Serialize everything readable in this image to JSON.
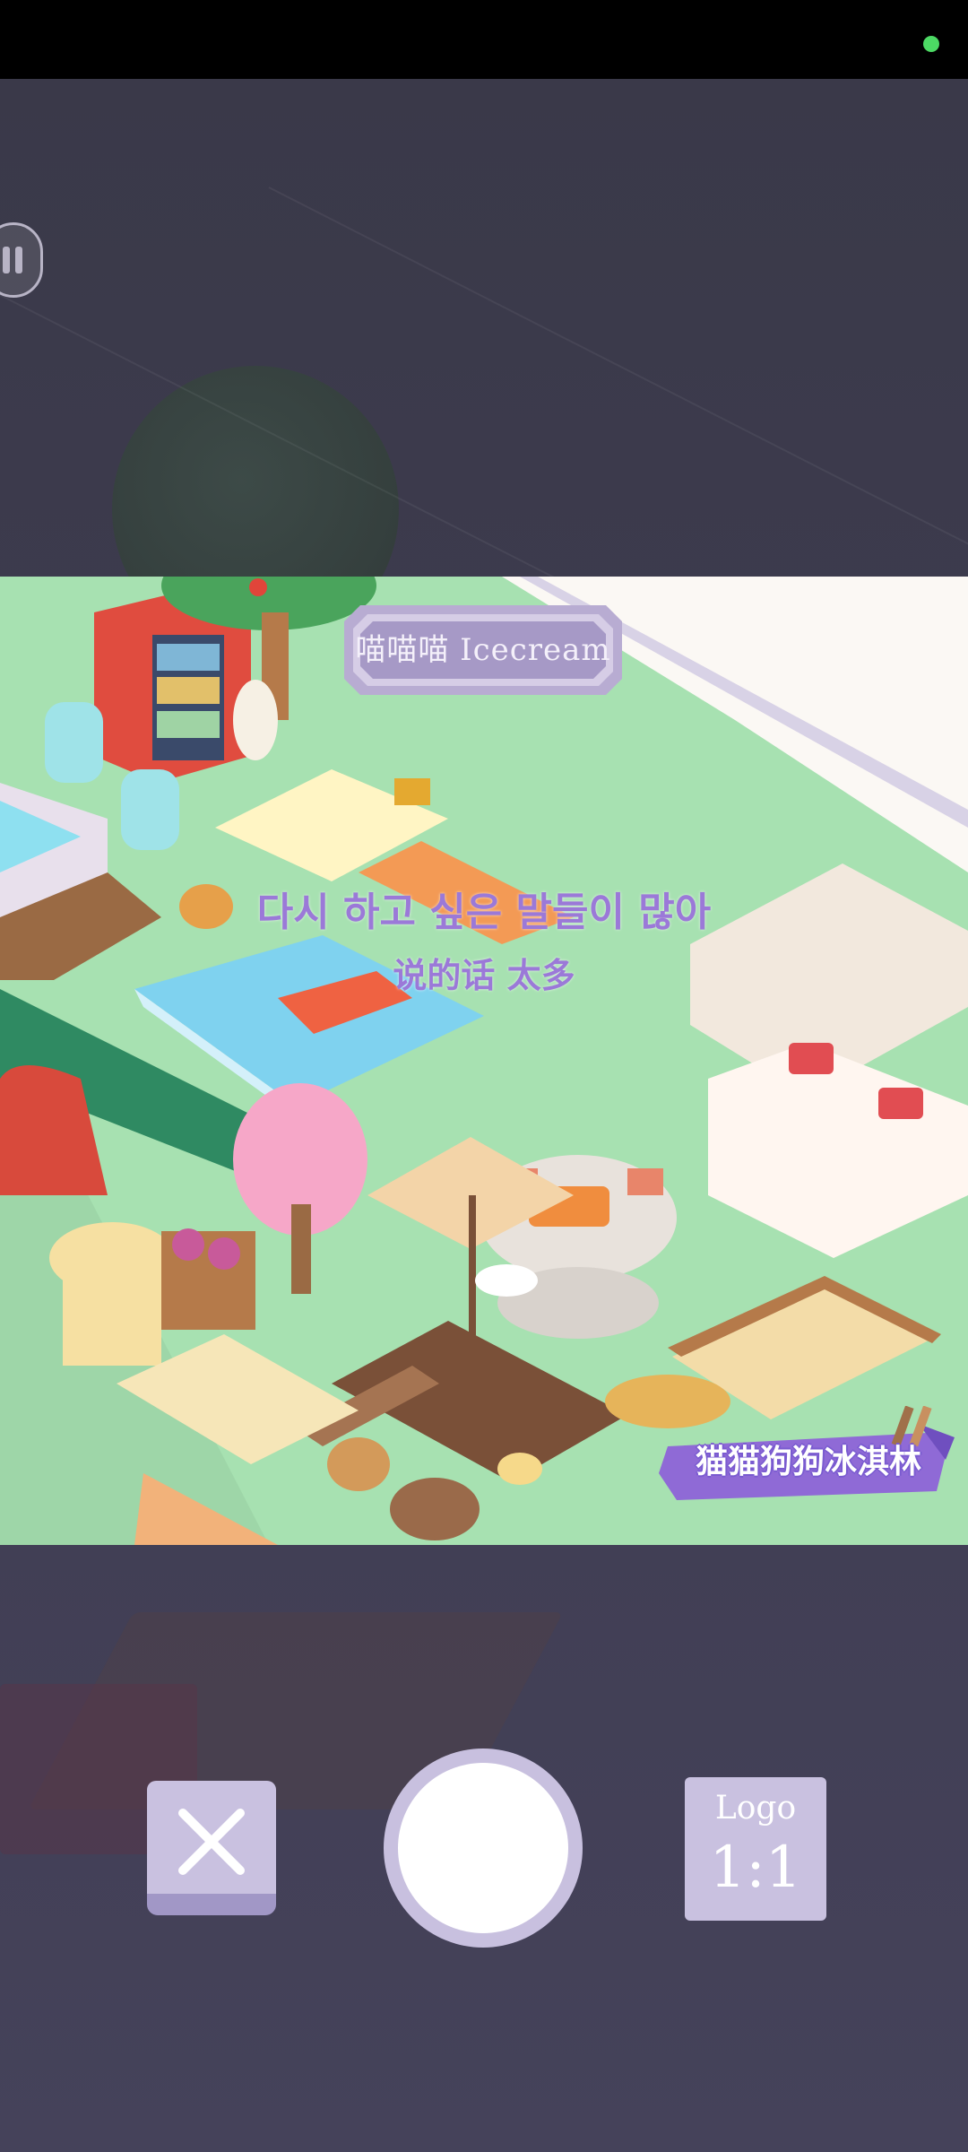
{
  "sign": {
    "text": "喵喵喵 Icecream"
  },
  "subtitles": {
    "korean": "다시 하고 싶은 말들이 많아",
    "chinese": "说的话 太多"
  },
  "watermark": {
    "text": "猫猫狗狗冰淇林"
  },
  "controls": {
    "close_icon": "close-x-icon",
    "logo_ratio_label": "Logo",
    "logo_ratio_value": "1:1"
  },
  "colors": {
    "grass": "#a7e1b1",
    "subtitle": "#9b79d8",
    "button": "#c9c1e0",
    "status_indicator": "#4cd964"
  }
}
